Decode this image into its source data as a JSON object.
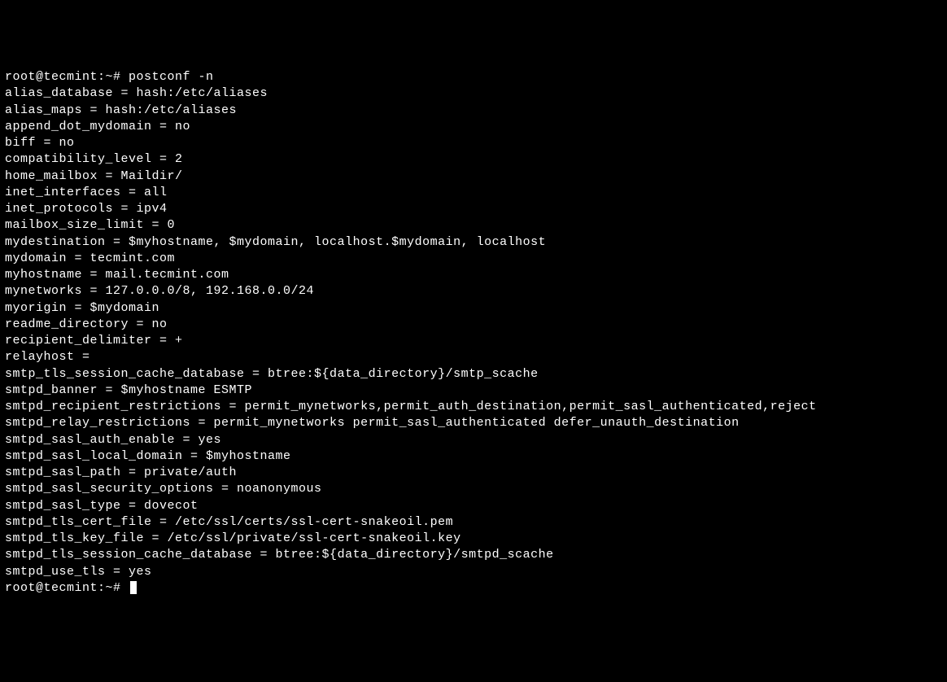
{
  "terminal": {
    "prompt1": "root@tecmint:~# ",
    "command": "postconf -n",
    "lines": [
      "alias_database = hash:/etc/aliases",
      "alias_maps = hash:/etc/aliases",
      "append_dot_mydomain = no",
      "biff = no",
      "compatibility_level = 2",
      "home_mailbox = Maildir/",
      "inet_interfaces = all",
      "inet_protocols = ipv4",
      "mailbox_size_limit = 0",
      "mydestination = $myhostname, $mydomain, localhost.$mydomain, localhost",
      "mydomain = tecmint.com",
      "myhostname = mail.tecmint.com",
      "mynetworks = 127.0.0.0/8, 192.168.0.0/24",
      "myorigin = $mydomain",
      "readme_directory = no",
      "recipient_delimiter = +",
      "relayhost =",
      "smtp_tls_session_cache_database = btree:${data_directory}/smtp_scache",
      "smtpd_banner = $myhostname ESMTP",
      "smtpd_recipient_restrictions = permit_mynetworks,permit_auth_destination,permit_sasl_authenticated,reject",
      "smtpd_relay_restrictions = permit_mynetworks permit_sasl_authenticated defer_unauth_destination",
      "smtpd_sasl_auth_enable = yes",
      "smtpd_sasl_local_domain = $myhostname",
      "smtpd_sasl_path = private/auth",
      "smtpd_sasl_security_options = noanonymous",
      "smtpd_sasl_type = dovecot",
      "smtpd_tls_cert_file = /etc/ssl/certs/ssl-cert-snakeoil.pem",
      "smtpd_tls_key_file = /etc/ssl/private/ssl-cert-snakeoil.key",
      "smtpd_tls_session_cache_database = btree:${data_directory}/smtpd_scache",
      "smtpd_use_tls = yes"
    ],
    "prompt2": "root@tecmint:~# "
  }
}
